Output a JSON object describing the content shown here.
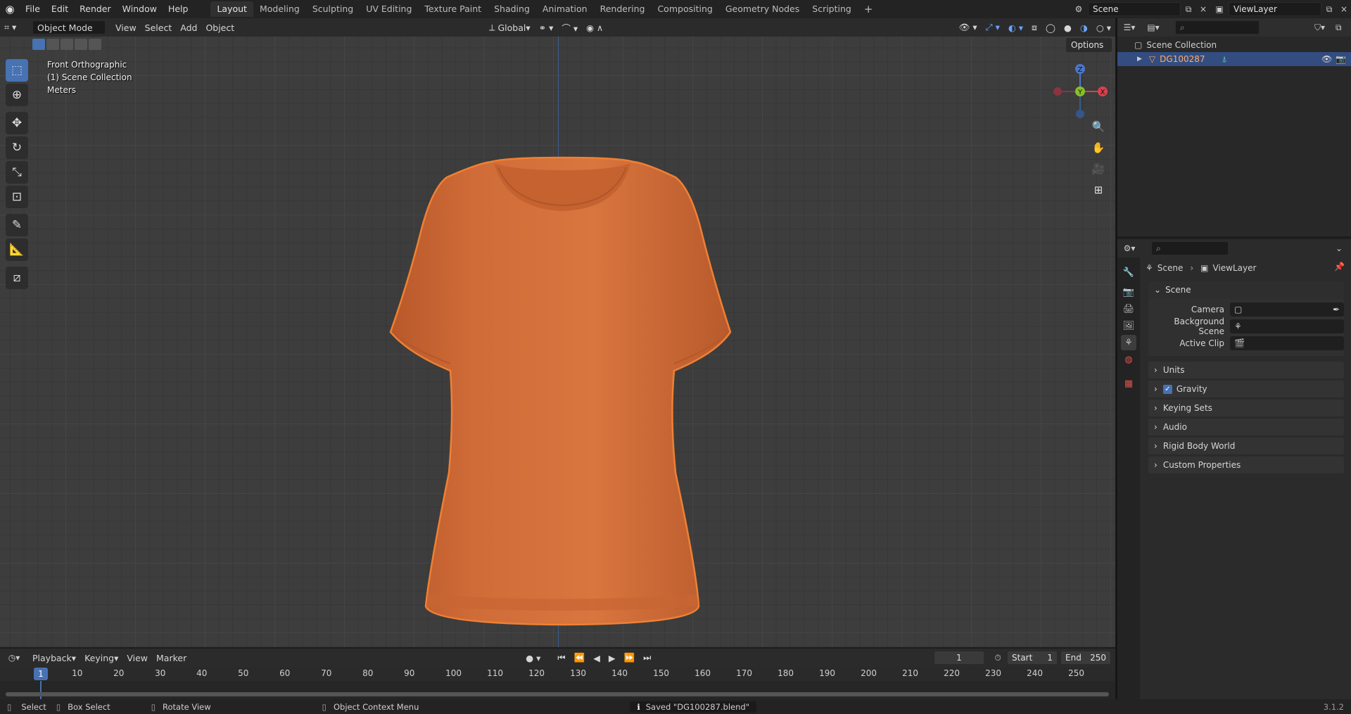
{
  "topbar": {
    "menus": [
      "File",
      "Edit",
      "Render",
      "Window",
      "Help"
    ],
    "workspaces": [
      "Layout",
      "Modeling",
      "Sculpting",
      "UV Editing",
      "Texture Paint",
      "Shading",
      "Animation",
      "Rendering",
      "Compositing",
      "Geometry Nodes",
      "Scripting"
    ],
    "active_workspace": "Layout",
    "add_tab": "+",
    "scene_name": "Scene",
    "view_layer_name": "ViewLayer"
  },
  "viewport_header": {
    "mode": "Object Mode",
    "menus": [
      "View",
      "Select",
      "Add",
      "Object"
    ],
    "orientation": "Global",
    "options_label": "Options"
  },
  "viewport": {
    "overlay_lines": [
      "Front Orthographic",
      "(1) Scene Collection",
      "Meters"
    ],
    "gizmo": {
      "z": "Z",
      "y": "Y",
      "x": "X"
    },
    "object_color": "#d2703a",
    "selection_outline": "#f08033"
  },
  "outliner": {
    "root": "Scene Collection",
    "items": [
      {
        "label": "DG100287",
        "type": "mesh"
      }
    ]
  },
  "properties": {
    "breadcrumb": [
      "Scene",
      "ViewLayer"
    ],
    "panel_title": "Scene",
    "rows": [
      {
        "label": "Camera",
        "value": ""
      },
      {
        "label": "Background Scene",
        "value": ""
      },
      {
        "label": "Active Clip",
        "value": ""
      }
    ],
    "subpanels": [
      "Units",
      "Gravity",
      "Keying Sets",
      "Audio",
      "Rigid Body World",
      "Custom Properties"
    ],
    "gravity_checked": true
  },
  "timeline": {
    "menus": [
      "Playback",
      "Keying",
      "View",
      "Marker"
    ],
    "current_frame": "1",
    "start_label": "Start",
    "start": "1",
    "end_label": "End",
    "end": "250",
    "ticks": [
      "1",
      "10",
      "20",
      "30",
      "40",
      "50",
      "60",
      "70",
      "80",
      "90",
      "100",
      "110",
      "120",
      "130",
      "140",
      "150",
      "160",
      "170",
      "180",
      "190",
      "200",
      "210",
      "220",
      "230",
      "240",
      "250"
    ]
  },
  "statusbar": {
    "select": "Select",
    "box_select": "Box Select",
    "rotate_view": "Rotate View",
    "context_menu": "Object Context Menu",
    "message": "Saved \"DG100287.blend\"",
    "version": "3.1.2"
  }
}
